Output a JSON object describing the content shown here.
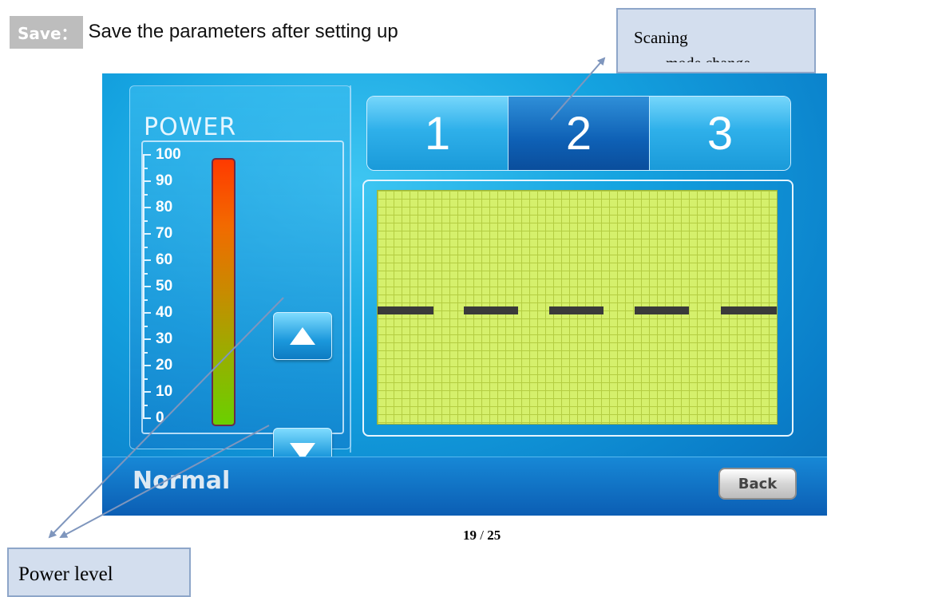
{
  "heading": {
    "tag": "Save：",
    "text": "Save the parameters after setting up"
  },
  "callouts": {
    "scanning": "Scaning",
    "scanning_cut": "mode change",
    "power_level": "Power level"
  },
  "device": {
    "power_title": "POWER",
    "scale_labels": [
      "100",
      "90",
      "80",
      "70",
      "60",
      "50",
      "40",
      "30",
      "20",
      "10",
      "0"
    ],
    "tabs": [
      {
        "label": "1",
        "active": false
      },
      {
        "label": "2",
        "active": true
      },
      {
        "label": "3",
        "active": false
      }
    ],
    "mode": "Normal",
    "back_label": "Back",
    "up_button_icon": "triangle-up-icon",
    "down_button_icon": "triangle-down-icon"
  },
  "footer": {
    "page": "19",
    "sep": " / ",
    "total": "25"
  },
  "colors": {
    "device_bg": "#15a3e0",
    "graph_bg": "#d5f06c",
    "bar_top": "#ff3a00",
    "bar_bottom": "#6ad000"
  }
}
